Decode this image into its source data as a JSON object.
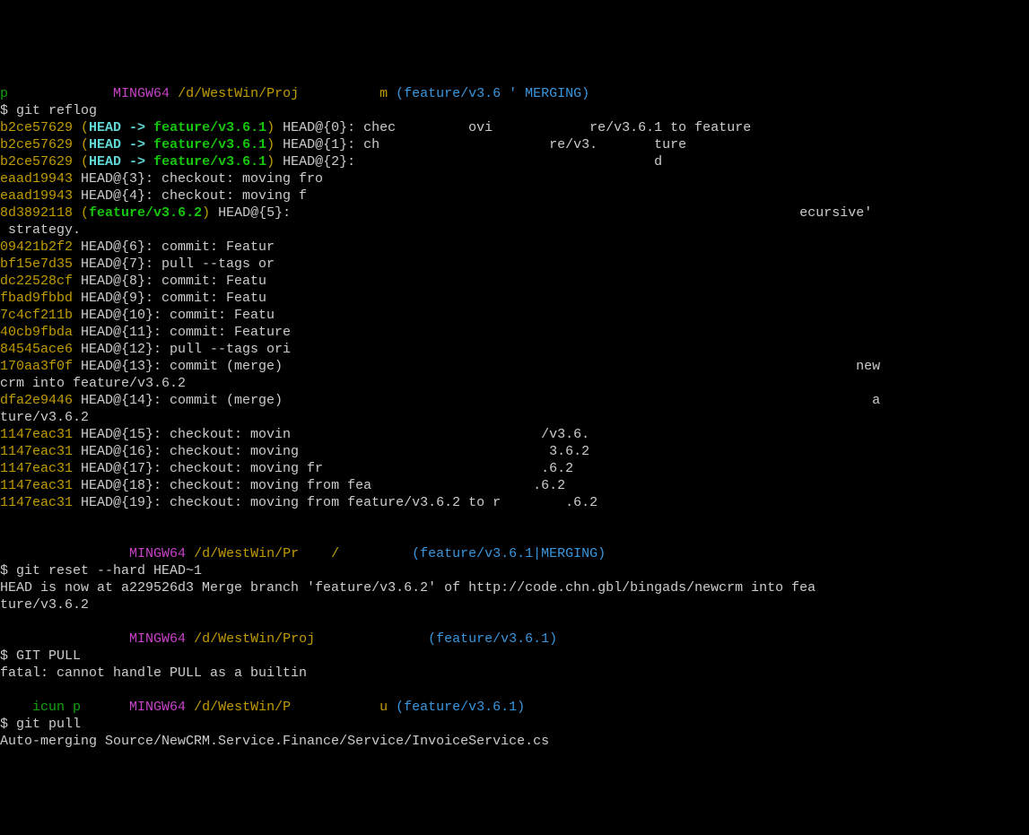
{
  "prompt0": {
    "env": "MINGW64",
    "path": "/d/WestWin/Proj          m",
    "branch": "(feature/v3.6 ' MERGING)"
  },
  "cmd0": "$ git reflog",
  "reflog": [
    {
      "hash": "b2ce57629",
      "ref": "(HEAD -> feature/v3.6.1)",
      "rest": " HEAD@{0}: chec         ovi            re/v3.6.1 to feature "
    },
    {
      "hash": "b2ce57629",
      "ref": "(HEAD -> feature/v3.6.1)",
      "rest": " HEAD@{1}: ch                     re/v3.       ture "
    },
    {
      "hash": "b2ce57629",
      "ref": "(HEAD -> feature/v3.6.1)",
      "rest": " HEAD@{2}:                                     d"
    },
    {
      "hash": "eaad19943",
      "ref": "",
      "rest": " HEAD@{3}: checkout: moving fro"
    },
    {
      "hash": "eaad19943",
      "ref": "",
      "rest": " HEAD@{4}: checkout: moving f"
    },
    {
      "hash": "8d3892118",
      "ref": "(feature/v3.6.2)",
      "rest": " HEAD@{5}:                                                               ecursive'"
    },
    {
      "hash": "",
      "ref": "",
      "rest": " strategy."
    },
    {
      "hash": "09421b2f2",
      "ref": "",
      "rest": " HEAD@{6}: commit: Featur"
    },
    {
      "hash": "bf15e7d35",
      "ref": "",
      "rest": " HEAD@{7}: pull --tags or"
    },
    {
      "hash": "dc22528cf",
      "ref": "",
      "rest": " HEAD@{8}: commit: Featu"
    },
    {
      "hash": "fbad9fbbd",
      "ref": "",
      "rest": " HEAD@{9}: commit: Featu"
    },
    {
      "hash": "7c4cf211b",
      "ref": "",
      "rest": " HEAD@{10}: commit: Featu"
    },
    {
      "hash": "40cb9fbda",
      "ref": "",
      "rest": " HEAD@{11}: commit: Feature"
    },
    {
      "hash": "84545ace6",
      "ref": "",
      "rest": " HEAD@{12}: pull --tags ori"
    },
    {
      "hash": "170aa3f0f",
      "ref": "",
      "rest": " HEAD@{13}: commit (merge)                                                                       new"
    },
    {
      "hash": "",
      "ref": "",
      "rest": "crm into feature/v3.6.2"
    },
    {
      "hash": "dfa2e9446",
      "ref": "",
      "rest": " HEAD@{14}: commit (merge)                                                                         a"
    },
    {
      "hash": "",
      "ref": "",
      "rest": "ture/v3.6.2"
    },
    {
      "hash": "1147eac31",
      "ref": "",
      "rest": " HEAD@{15}: checkout: movin                               /v3.6."
    },
    {
      "hash": "1147eac31",
      "ref": "",
      "rest": " HEAD@{16}: checkout: moving                               3.6.2"
    },
    {
      "hash": "1147eac31",
      "ref": "",
      "rest": " HEAD@{17}: checkout: moving fr                           .6.2"
    },
    {
      "hash": "1147eac31",
      "ref": "",
      "rest": " HEAD@{18}: checkout: moving from fea                    .6.2"
    },
    {
      "hash": "1147eac31",
      "ref": "",
      "rest": " HEAD@{19}: checkout: moving from feature/v3.6.2 to r        .6.2"
    }
  ],
  "prompt1": {
    "env": "MINGW64",
    "path": "/d/WestWin/Pr    / ",
    "branch": "(feature/v3.6.1|MERGING)"
  },
  "cmd1": "$ git reset --hard HEAD~1",
  "out1": "HEAD is now at a229526d3 Merge branch 'feature/v3.6.2' of http://code.chn.gbl/bingads/newcrm into fea\nture/v3.6.2",
  "prompt2": {
    "env": "MINGW64",
    "path": "/d/WestWin/Proj",
    "branch": "(feature/v3.6.1)"
  },
  "cmd2": "$ GIT PULL",
  "out2": "fatal: cannot handle PULL as a builtin",
  "prompt3": {
    "env": "MINGW64",
    "path": "/d/WestWin/P           u",
    "branch": "(feature/v3.6.1)"
  },
  "cmd3": "$ git pull",
  "out3": "Auto-merging Source/NewCRM.Service.Finance/Service/InvoiceService.cs"
}
